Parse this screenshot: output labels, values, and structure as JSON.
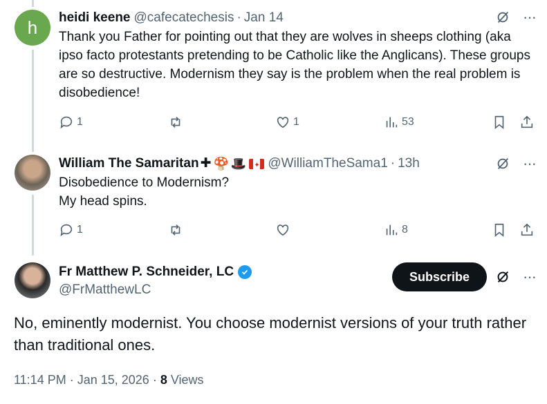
{
  "reply1": {
    "avatar_letter": "h",
    "name": "heidi keene",
    "handle": "@cafecatechesis",
    "time": "Jan 14",
    "text": "Thank you Father for pointing out that they are wolves in sheeps clothing (aka ipso facto protestants pretending to be Catholic like the Anglicans). These groups are so destructive. Modernism they say is the problem when the real problem is disobedience!",
    "replies": "1",
    "reposts": "",
    "likes": "1",
    "views": "53"
  },
  "reply2": {
    "name": "William The Samaritan",
    "name_suffix": "✚",
    "handle": "@WilliamTheSama1",
    "time": "13h",
    "text_line1": "Disobedience to Modernism?",
    "text_line2": "My head spins.",
    "replies": "1",
    "reposts": "",
    "likes": "",
    "views": "8"
  },
  "main": {
    "name": "Fr Matthew P. Schneider, LC",
    "handle": "@FrMatthewLC",
    "subscribe_label": "Subscribe",
    "text": "No, eminently modernist. You choose modernist versions of your truth rather than traditional ones.",
    "timestamp": "11:14 PM · Jan 15, 2026",
    "views_count": "8",
    "views_label": "Views"
  },
  "colors": {
    "accent": "#1d9bf0",
    "muted": "#536471",
    "text": "#0f1419",
    "avatar_h": "#6aa84f"
  },
  "icons": [
    "grok-icon",
    "more-icon",
    "reply-icon",
    "repost-icon",
    "like-icon",
    "views-icon",
    "bookmark-icon",
    "share-icon",
    "verified-icon"
  ]
}
